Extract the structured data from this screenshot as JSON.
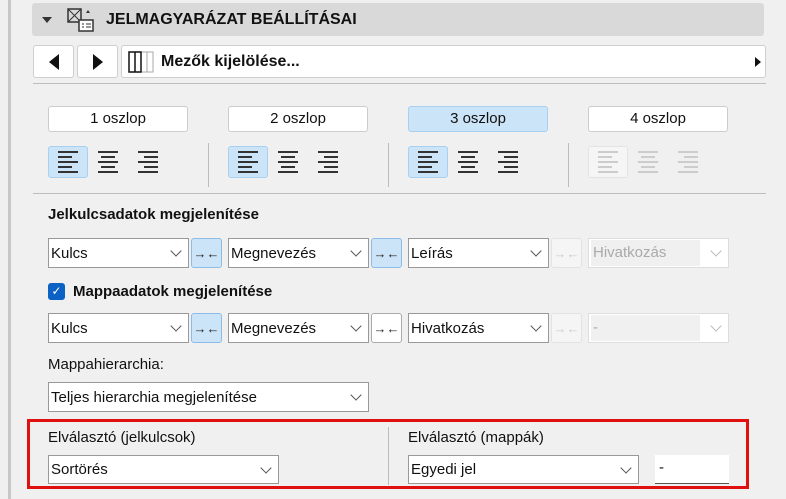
{
  "header": {
    "title": "JELMAGYARÁZAT BEÁLLÍTÁSAI"
  },
  "nav": {
    "field_select": "Mezők kijelölése..."
  },
  "columns": [
    {
      "label": "1 oszlop",
      "active": false
    },
    {
      "label": "2 oszlop",
      "active": false
    },
    {
      "label": "3 oszlop",
      "active": true
    },
    {
      "label": "4 oszlop",
      "active": false
    }
  ],
  "key_data": {
    "title": "Jelkulcsadatok megjelenítése",
    "fields": [
      "Kulcs",
      "Megnevezés",
      "Leírás",
      "Hivatkozás"
    ]
  },
  "folder_data": {
    "title": "Mappaadatok megjelenítése",
    "checked": true,
    "fields": [
      "Kulcs",
      "Megnevezés",
      "Hivatkozás",
      "-"
    ]
  },
  "hierarchy": {
    "label": "Mappahierarchia:",
    "value": "Teljes hierarchia megjelenítése"
  },
  "separator_keys": {
    "label": "Elválasztó (jelkulcsok)",
    "value": "Sortörés"
  },
  "separator_folders": {
    "label": "Elválasztó (mappák)",
    "value": "Egyedi jel",
    "custom": "-"
  },
  "colors": {
    "accent": "#0b62c4",
    "highlight": "#cce4f7",
    "outline": "#e01010"
  }
}
